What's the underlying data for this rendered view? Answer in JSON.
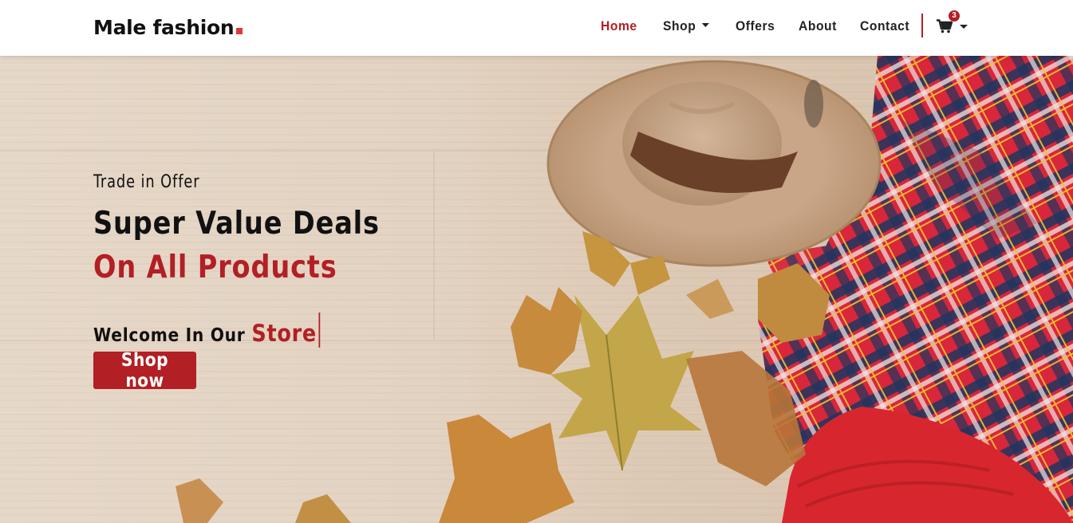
{
  "brand": {
    "name": "Male fashion",
    "accent": "#e53637"
  },
  "nav": {
    "items": [
      {
        "label": "Home",
        "active": true
      },
      {
        "label": "Shop",
        "dropdown": true
      },
      {
        "label": "Offers"
      },
      {
        "label": "About"
      },
      {
        "label": "Contact"
      }
    ],
    "cart": {
      "icon": "cart-icon",
      "count": "3"
    }
  },
  "hero": {
    "tagline": "Trade in Offer",
    "headline_1": "Super Value Deals",
    "headline_2": "On All Products",
    "welcome": "Welcome In Our",
    "welcome_highlight": "Store",
    "cta_label": "Shop now",
    "accent": "#b21f24",
    "image_subject": "hat-plaid-shirt-autumn-leaves"
  }
}
